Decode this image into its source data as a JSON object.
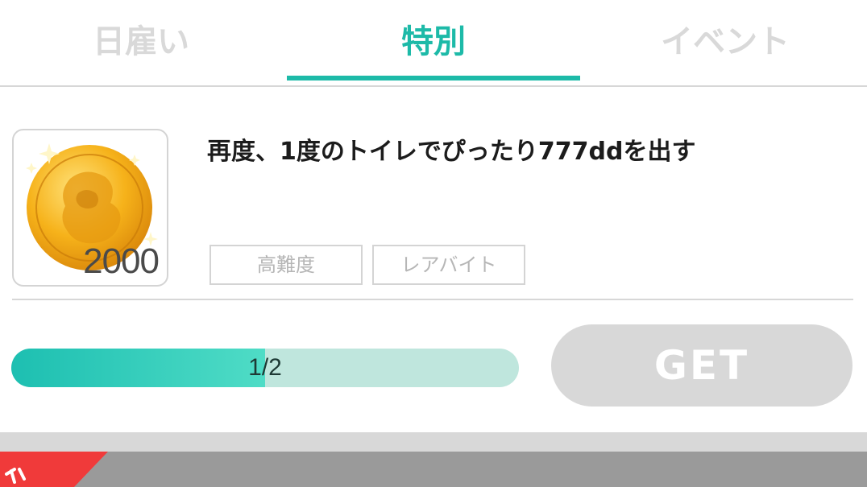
{
  "tabs": [
    {
      "label": "日雇い",
      "active": false
    },
    {
      "label": "特別",
      "active": true
    },
    {
      "label": "イベント",
      "active": false
    }
  ],
  "colors": {
    "accent": "#1dbaa8",
    "inactive_tab": "#d9d9d9",
    "button_disabled": "#d8d8d8",
    "ribbon": "#f03a3a"
  },
  "mission": {
    "reward_icon": "gold-coin-icon",
    "reward_amount": "2000",
    "title": "再度、1度のトイレでぴったり777ddを出す",
    "tags": [
      "高難度",
      "レアバイト"
    ],
    "progress": {
      "current": 1,
      "total": 2,
      "label": "1/2"
    },
    "claim_button_label": "GET"
  }
}
